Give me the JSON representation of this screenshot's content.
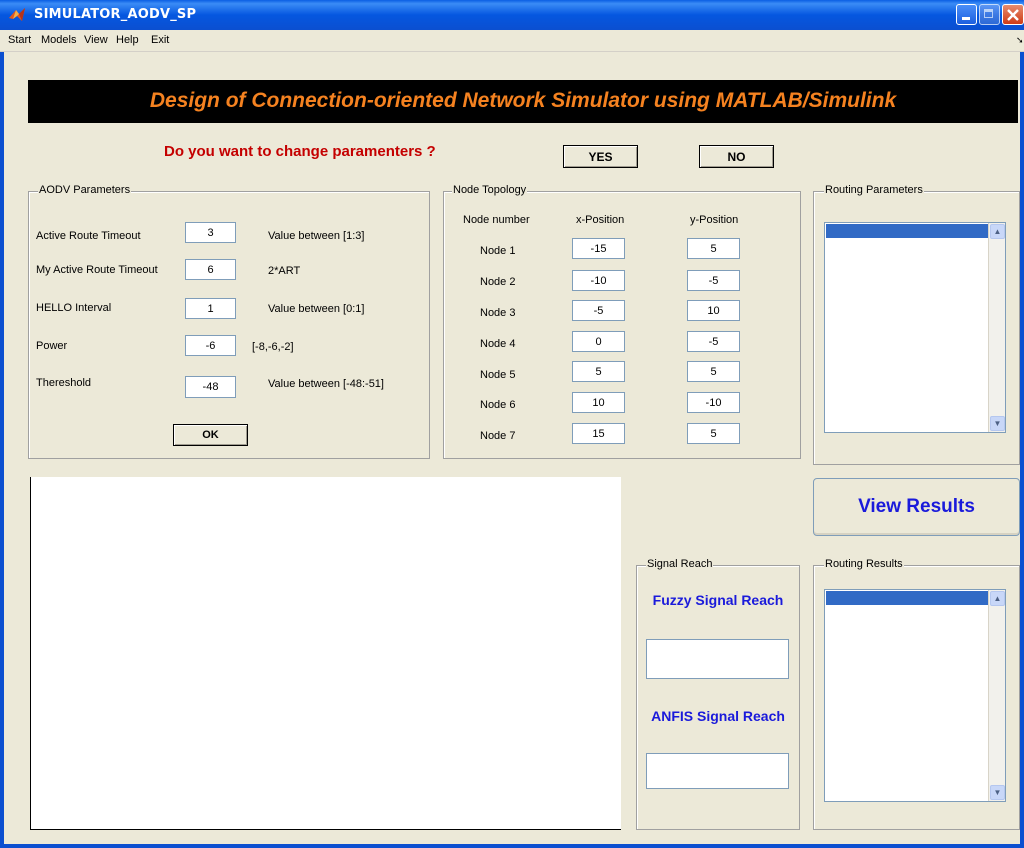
{
  "window": {
    "title": "SIMULATOR_AODV_SP"
  },
  "menu": [
    "Start",
    "Models",
    "View",
    "Help",
    "Exit"
  ],
  "banner": "Design of Connection-oriented Network Simulator using MATLAB/Simulink",
  "question": {
    "text": "Do you want to change paramenters ?",
    "yes_label": "YES",
    "no_label": "NO"
  },
  "aodv": {
    "title": "AODV Parameters",
    "params": [
      {
        "label": "Active Route Timeout",
        "value": "3",
        "hint": "Value between [1:3]"
      },
      {
        "label": "My Active Route Timeout",
        "value": "6",
        "hint": "2*ART"
      },
      {
        "label": "HELLO Interval",
        "value": "1",
        "hint": "Value between [0:1]"
      },
      {
        "label": "Power",
        "value": "-6",
        "hint": "[-8,-6,-2]"
      },
      {
        "label": "Thereshold",
        "value": "-48",
        "hint": "Value between [-48:-51]"
      }
    ],
    "ok_label": "OK"
  },
  "topology": {
    "title": "Node Topology",
    "headers": [
      "Node number",
      "x-Position",
      "y-Position"
    ],
    "nodes": [
      {
        "name": "Node 1",
        "x": "-15",
        "y": "5"
      },
      {
        "name": "Node 2",
        "x": "-10",
        "y": "-5"
      },
      {
        "name": "Node 3",
        "x": "-5",
        "y": "10"
      },
      {
        "name": "Node 4",
        "x": "0",
        "y": "-5"
      },
      {
        "name": "Node 5",
        "x": "5",
        "y": "5"
      },
      {
        "name": "Node 6",
        "x": "10",
        "y": "-10"
      },
      {
        "name": "Node 7",
        "x": "15",
        "y": "5"
      }
    ]
  },
  "routing_params": {
    "title": "Routing Parameters"
  },
  "view_results_label": "View Results",
  "signal_reach": {
    "title": "Signal Reach",
    "fuzzy_label": "Fuzzy Signal Reach",
    "fuzzy_value": "",
    "anfis_label": "ANFIS Signal Reach",
    "anfis_value": ""
  },
  "routing_results": {
    "title": "Routing Results"
  },
  "colors": {
    "background": "#ece9d8",
    "banner_bg": "#000000",
    "banner_text": "#f58220",
    "question_text": "#c40000",
    "accent_blue": "#1a1adb",
    "selection": "#316ac5"
  },
  "icons": [
    "matlab-icon",
    "minimize-icon",
    "maximize-icon",
    "close-icon",
    "scroll-up-icon",
    "scroll-down-icon"
  ]
}
